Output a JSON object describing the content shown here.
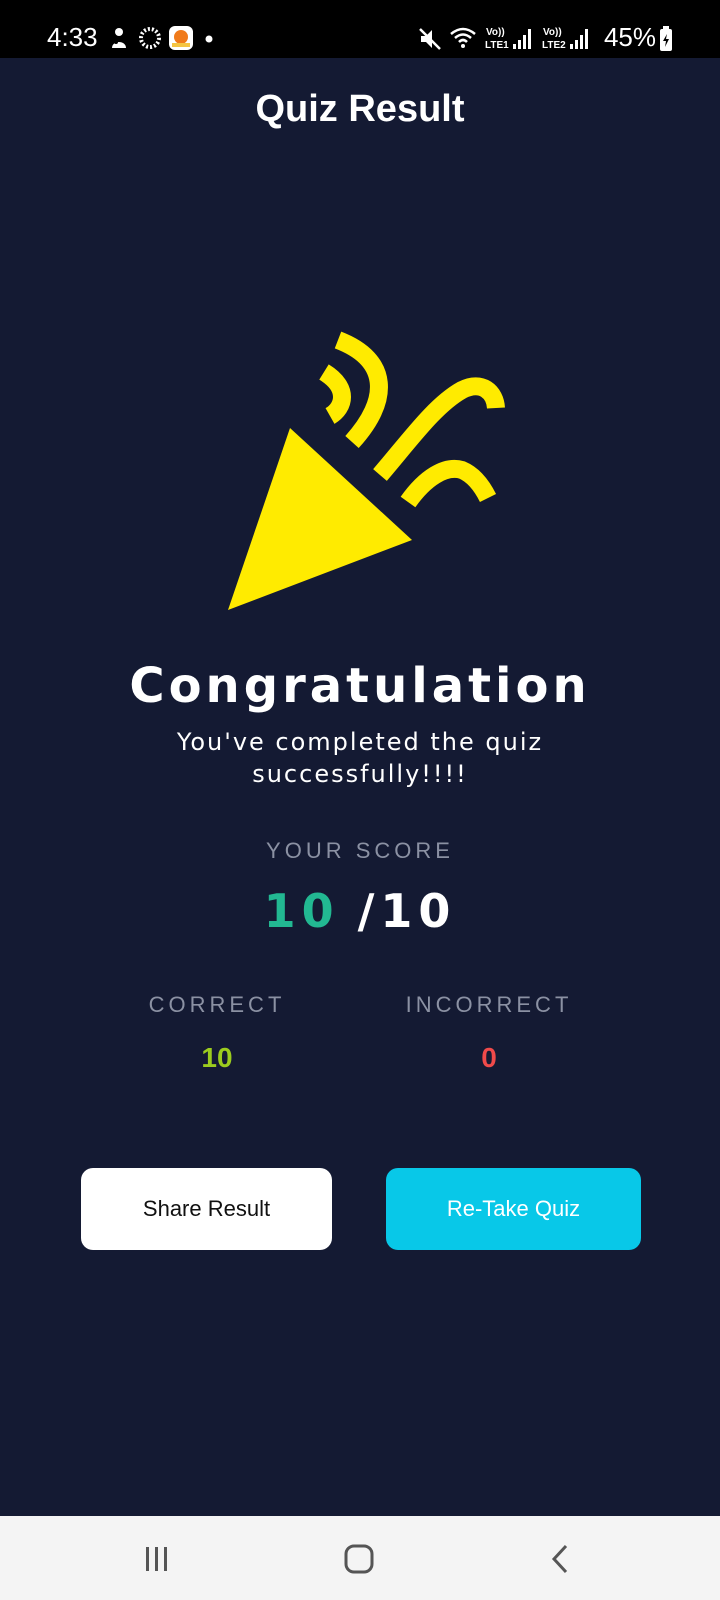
{
  "status_bar": {
    "time": "4:33",
    "battery": "45%",
    "icons": [
      "app-notification-icon",
      "loading-icon",
      "app-icon",
      "notification-dot-icon",
      "mute-icon",
      "wifi-icon",
      "signal-lte1-icon",
      "signal-lte2-icon",
      "battery-icon"
    ],
    "lte1_label": "LTE1",
    "lte2_label": "LTE2",
    "volte_label": "Vo))"
  },
  "header": {
    "title": "Quiz Result"
  },
  "hero": {
    "icon": "party-popper-icon",
    "accent_color": "#ffeb00"
  },
  "result": {
    "heading": "Congratulation",
    "message": "You've completed the quiz successfully!!!!",
    "score_label": "YOUR SCORE",
    "score_value": "10",
    "score_total": "/10",
    "correct_label": "CORRECT",
    "correct_value": "10",
    "incorrect_label": "INCORRECT",
    "incorrect_value": "0"
  },
  "actions": {
    "share_label": "Share Result",
    "retake_label": "Re-Take Quiz"
  },
  "nav": {
    "icons": [
      "recent-apps-icon",
      "home-icon",
      "back-icon"
    ]
  },
  "colors": {
    "background": "#141a33",
    "score_accent": "#22b892",
    "correct": "#9ccc1e",
    "incorrect": "#f04a4a",
    "primary_button": "#08c8e8"
  }
}
